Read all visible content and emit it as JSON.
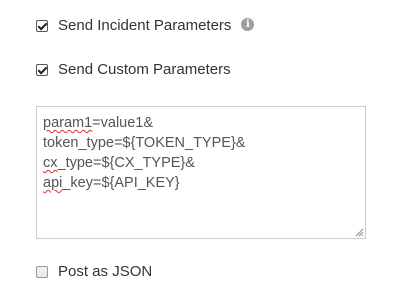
{
  "options": {
    "send_incident": {
      "label": "Send Incident Parameters",
      "checked": true,
      "info_icon": "info-icon"
    },
    "send_custom": {
      "label": "Send Custom Parameters",
      "checked": true
    },
    "post_as_json": {
      "label": "Post as JSON",
      "checked": false
    }
  },
  "custom_params": {
    "lines": [
      {
        "misspelled": "param1",
        "rest": "=value1&"
      },
      {
        "misspelled": "",
        "rest": "token_type=${TOKEN_TYPE}&"
      },
      {
        "misspelled": "cx",
        "rest": "_type=${CX_TYPE}&"
      },
      {
        "misspelled": "api",
        "rest": "_key=${API_KEY}"
      }
    ]
  },
  "colors": {
    "text": "#333333",
    "spellcheck_underline": "#e03030",
    "info_icon_bg": "#9e9e9e",
    "border": "#cccccc"
  }
}
